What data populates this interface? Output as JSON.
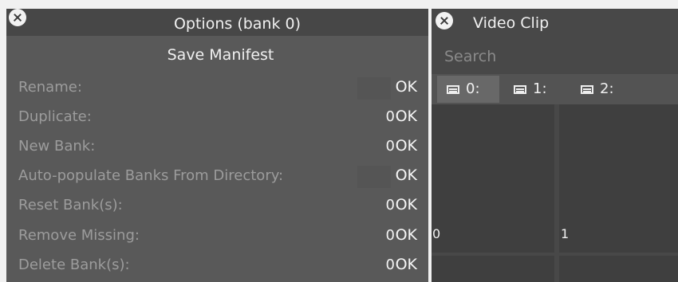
{
  "options_panel": {
    "title": "Options (bank 0)",
    "save_manifest_label": "Save Manifest",
    "rows": [
      {
        "label": "Rename:",
        "count": "",
        "ok": "OK"
      },
      {
        "label": "Duplicate:",
        "count": "0",
        "ok": "OK"
      },
      {
        "label": "New Bank:",
        "count": "0",
        "ok": "OK"
      },
      {
        "label": "Auto-populate Banks From Directory:",
        "count": "",
        "ok": "OK"
      },
      {
        "label": "Reset Bank(s):",
        "count": "0",
        "ok": "OK"
      },
      {
        "label": "Remove Missing:",
        "count": "0",
        "ok": "OK"
      },
      {
        "label": "Delete Bank(s):",
        "count": "0",
        "ok": "OK"
      }
    ]
  },
  "video_clip_panel": {
    "title": "Video Clip",
    "search_placeholder": "Search",
    "tabs": [
      {
        "label": "0:",
        "icon": "bank-icon",
        "active": true
      },
      {
        "label": "1:",
        "icon": "bank-icon",
        "active": false
      },
      {
        "label": "2:",
        "icon": "bank-icon",
        "active": false
      }
    ],
    "grid_cells": [
      {
        "label": "0"
      },
      {
        "label": "1"
      },
      {
        "label": ""
      },
      {
        "label": ""
      }
    ]
  }
}
